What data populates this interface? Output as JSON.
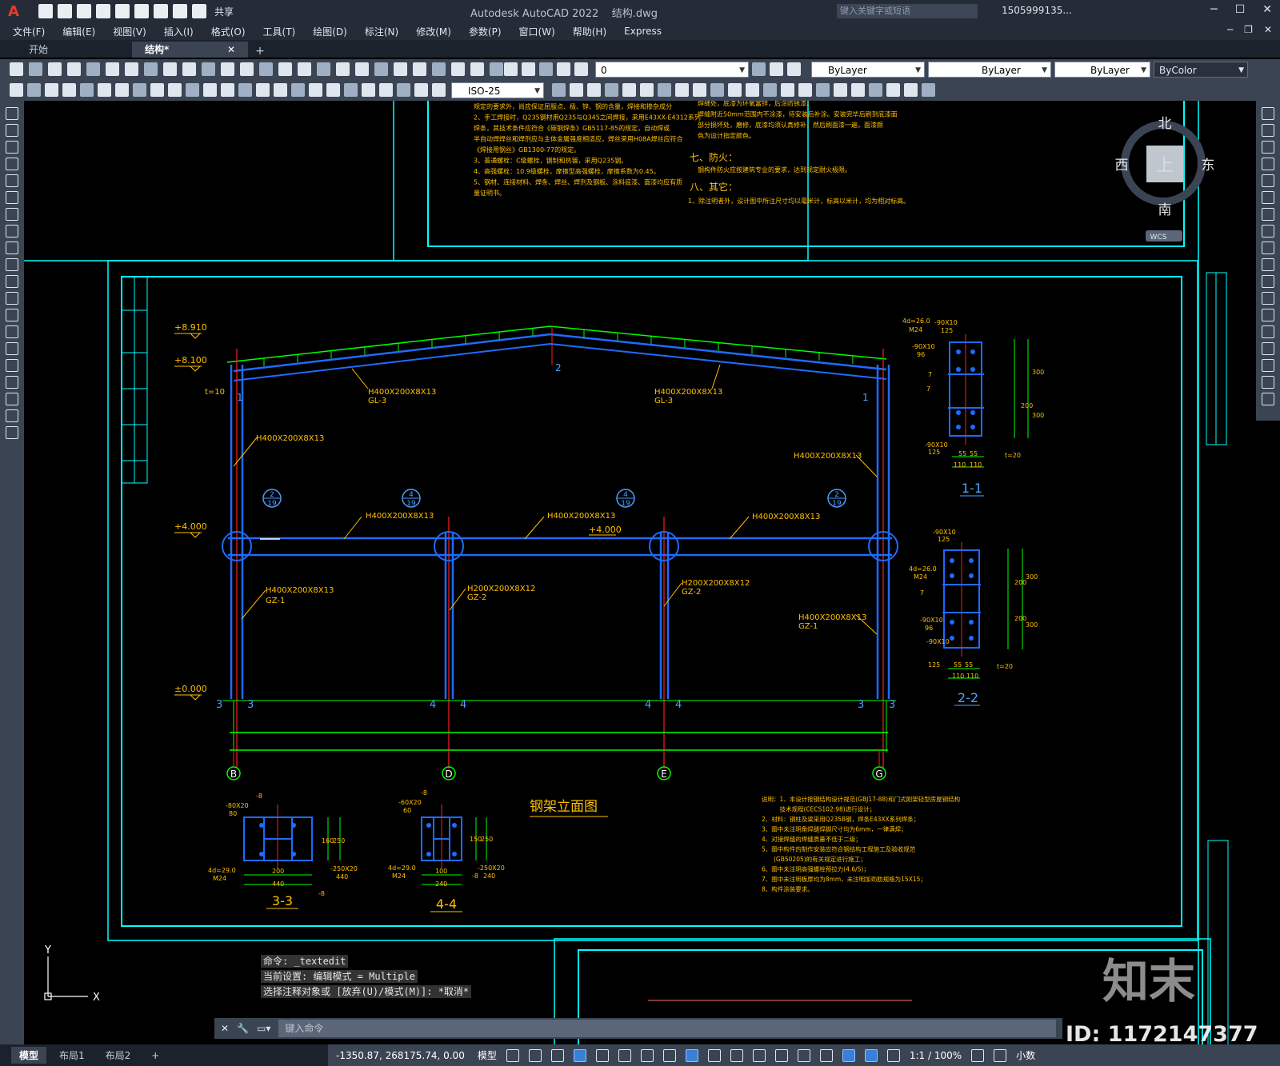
{
  "app": {
    "logo": "A",
    "title": "Autodesk AutoCAD 2022",
    "filename": "结构.dwg",
    "share_label": "共享",
    "search_placeholder": "键入关键字或短语",
    "user": "1505999135..."
  },
  "menu": [
    "文件(F)",
    "编辑(E)",
    "视图(V)",
    "插入(I)",
    "格式(O)",
    "工具(T)",
    "绘图(D)",
    "标注(N)",
    "修改(M)",
    "参数(P)",
    "窗口(W)",
    "帮助(H)",
    "Express"
  ],
  "tabs": {
    "start": "开始",
    "active": "结构*",
    "add": "+"
  },
  "toolbar": {
    "layer_value": "0",
    "color": "ByLayer",
    "linetype": "ByLayer",
    "lineweight": "ByLayer",
    "plotstyle": "ByColor",
    "dimstyle": "ISO-25"
  },
  "viewcube": {
    "north": "北",
    "south": "南",
    "east": "东",
    "west": "西",
    "face": "上",
    "wcs": "WCS"
  },
  "drawing": {
    "notes_top_left": [
      "规定的要求外，尚应保证屈服点、极、锌、钢的含量，焊接和掺杂成分",
      "2、手工焊接时，Q235钢材用Q235与Q345之间焊接，采用E43XX-E4312系列",
      "焊条，其技术条件应符合《碳钢焊条》GB5117-85的规定，自动焊或",
      "半自动焊焊丝和焊剂应与主体金属强度相适应，焊丝采用H08A焊丝应符合",
      "《焊接用钢丝》GB1300-77的规定。",
      "3、普通螺栓：C级螺栓，钢制和热镀，采用Q235钢。",
      "4、高强螺栓：10.9级螺栓，摩擦型高强螺栓，摩擦系数为0.45。",
      "5、钢材、连接材料、焊条、焊丝、焊剂及钢板、涂料底漆、面漆均应有质",
      "量证明书。"
    ],
    "notes_top_right": [
      "焊缝处，底漆为环氧富锌，后涂防锈漆。",
      "焊缝附近50mm范围内不涂漆，待安装后补涂。安装完毕后刷到底漆面",
      "部分损坏处，磨修，底漆均须认真修补，然后刷面漆一遍，面漆颜",
      "色为设计指定颜色。"
    ],
    "section7_title": "七、防火：",
    "section7_text": "钢构件防火应按建筑专业的要求，达到规定耐火极限。",
    "section8_title": "八、其它：",
    "section8_text": "1、除注明者外，设计图中所注尺寸均以毫米计，标高以米计，均为相对标高。",
    "elevations": [
      "+8.910",
      "+8.100",
      "+4.000",
      "±0.000"
    ],
    "mid_elev": "+4.000",
    "beam_labels": [
      "H400X200X8X13",
      "GL-3",
      "H400X200X8X13",
      "GL-3"
    ],
    "col_labels": [
      "H400X200X8X13",
      "H400X200X8X13",
      "GZ-1",
      "H200X200X8X12",
      "GZ-2",
      "H200X200X8X12",
      "GZ-2",
      "H400X200X8X13",
      "GZ-1",
      "H400X200X8X13"
    ],
    "mid_beams": [
      "H400X200X8X13",
      "H400X200X8X13",
      "H400X200X8X13"
    ],
    "t10": "t=10",
    "marks": [
      "1",
      "1",
      "2",
      "1"
    ],
    "circ_refs": [
      [
        "2",
        "19"
      ],
      [
        "4",
        "19"
      ],
      [
        "4",
        "19"
      ],
      [
        "2",
        "19"
      ]
    ],
    "sec_marks": [
      "3",
      "3",
      "4",
      "4",
      "4",
      "4",
      "3",
      "3"
    ],
    "axes": [
      "B",
      "D",
      "E",
      "G"
    ],
    "frame_title": "钢架立面图",
    "detail_1_1": "1-1",
    "detail_2_2": "2-2",
    "detail_3_3": "3-3",
    "detail_4_4": "4-4",
    "d11": {
      "bolt": "4d=26.0",
      "m": "M24",
      "plate1": "-90X10",
      "plate1b": "125",
      "plate2": "-90X10",
      "plate2b": "96",
      "dims": [
        "300",
        "200",
        "300"
      ],
      "bottom": [
        "55",
        "55",
        "110",
        "110"
      ],
      "t": "t=20",
      "weld": "7"
    },
    "d33": {
      "plate": "-80X20",
      "pb": "80",
      "bolt": "4d=29.0",
      "m": "M24",
      "dims": [
        "200",
        "440"
      ],
      "side": [
        "160",
        "250"
      ],
      "pl2": "-250X20",
      "pl2b": "440",
      "w": "-8"
    },
    "d44": {
      "plate": "-60X20",
      "pb": "60",
      "bolt": "4d=29.0",
      "m": "M24",
      "dims": [
        "100",
        "240"
      ],
      "side": [
        "150",
        "250"
      ],
      "pl2": "-250X20",
      "pl2b": "240",
      "w": "-8"
    },
    "notes_bottom": [
      "说明：1、本设计按钢结构设计规范(GBJ17-88)和门式刚架轻型房屋钢结构",
      "　　　技术规程(CECS102:98)进行设计；",
      "2、材料：钢柱及梁采用Q235B钢，焊条E43XX系列焊条；",
      "3、图中未注明角焊缝焊脚尺寸均为6mm，一律满焊；",
      "4、对接焊缝的焊缝质量不低于二级；",
      "5、图中构件的制作安装应符合钢结构工程施工及验收规范",
      "　　(GB50205)的有关规定进行施工；",
      "6、图中未注明高强螺栓预拉力(4.6/S)；",
      "7、图中未注明板厚均为8mm，未注明加劲肋规格为15X15；",
      "8、构件涂装要求。"
    ]
  },
  "command": {
    "history": [
      "命令: _textedit",
      "当前设置: 编辑模式 = Multiple",
      "选择注释对象或 [放弃(U)/模式(M)]: *取消*"
    ],
    "placeholder": "键入命令"
  },
  "layouts": [
    "模型",
    "布局1",
    "布局2",
    "+"
  ],
  "status": {
    "coords": "-1350.87, 268175.74, 0.00",
    "model": "模型",
    "scale": "1:1 / 100%",
    "units": "小数"
  },
  "watermark": {
    "id": "ID: 1172147377",
    "brand": "知末"
  },
  "colors": {
    "cyan": "#00ffff",
    "blue": "#1e6bff",
    "yellow": "#ffc000",
    "green": "#00ff00",
    "red": "#ff2020",
    "ui": "#3b4453"
  }
}
